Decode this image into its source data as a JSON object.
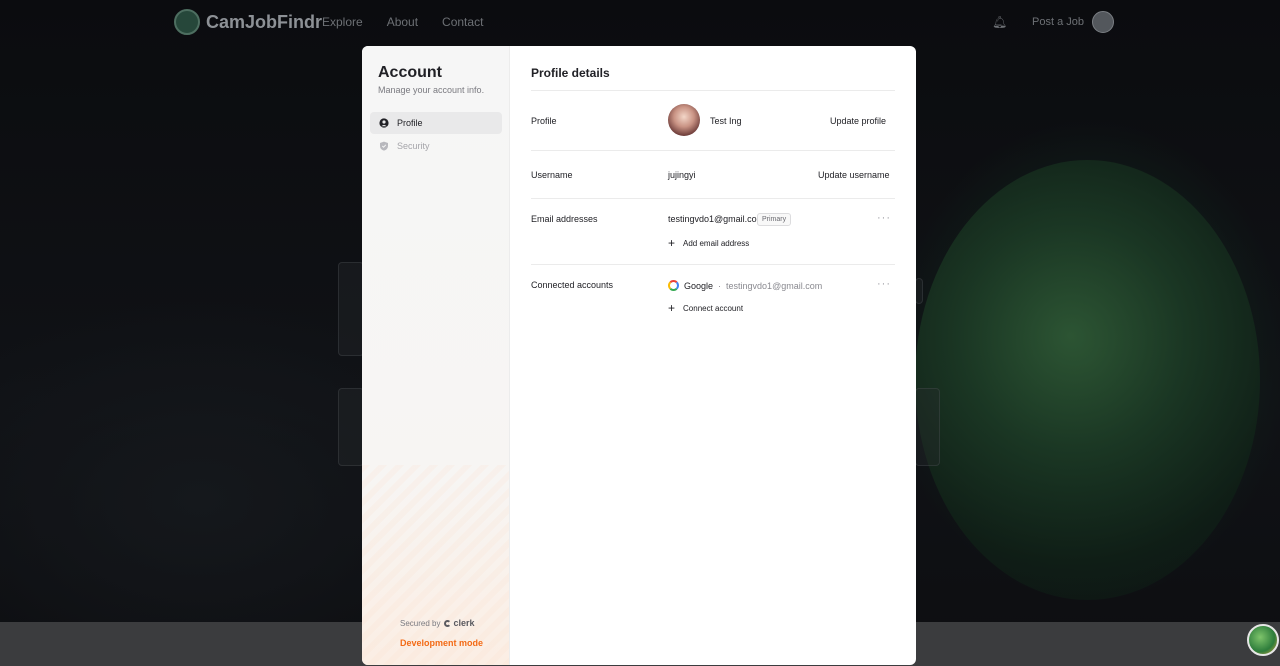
{
  "background": {
    "brand": "CamJobFindr",
    "nav_links": [
      "Explore",
      "About",
      "Contact"
    ],
    "bell_icon": "bell-icon",
    "post_job": "Post a Job"
  },
  "sidebar": {
    "title": "Account",
    "subtitle": "Manage your account info.",
    "items": [
      {
        "label": "Profile",
        "icon": "user-icon",
        "active": true
      },
      {
        "label": "Security",
        "icon": "shield-icon",
        "active": false
      }
    ],
    "secured_by": "Secured by",
    "brand": "clerk",
    "dev_mode": "Development mode"
  },
  "main": {
    "title": "Profile details",
    "profile": {
      "label": "Profile",
      "name": "Test Ing",
      "action": "Update profile"
    },
    "username": {
      "label": "Username",
      "value": "jujingyi",
      "action": "Update username"
    },
    "email": {
      "label": "Email addresses",
      "value": "testingvdo1@gmail.com",
      "badge": "Primary",
      "add": "Add email address",
      "more": "···"
    },
    "connected": {
      "label": "Connected accounts",
      "provider": "Google",
      "separator": "·",
      "email": "testingvdo1@gmail.com",
      "add": "Connect account",
      "more": "···"
    },
    "close": "✕"
  },
  "colors": {
    "accent_dev": "#f36b16",
    "active_bg": "#e9e9ea"
  }
}
